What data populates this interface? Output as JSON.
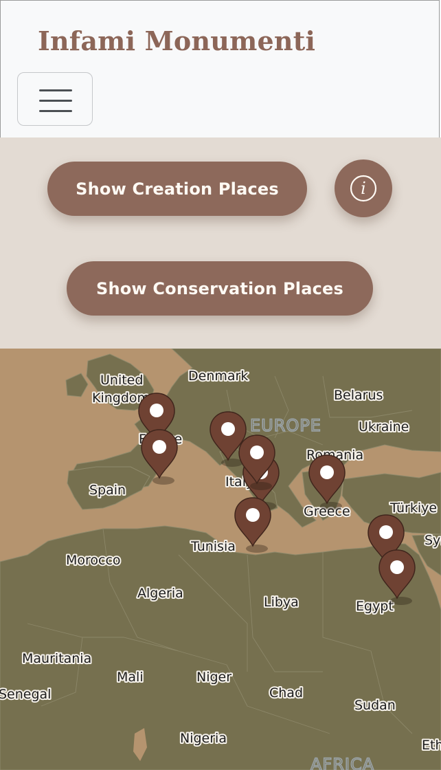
{
  "navbar": {
    "brand": "Infami Monumenti",
    "toggler_icon": "hamburger-menu-icon"
  },
  "controls": {
    "creation_button": "Show Creation Places",
    "conservation_button": "Show Conservation Places",
    "info_icon": "info-icon",
    "accent_color": "#8d695b"
  },
  "map": {
    "land_color": "#76704f",
    "sea_color": "#b5946f",
    "marker_color": "#6f4233",
    "region_labels": {
      "europe": "EUROPE",
      "africa": "AFRICA"
    },
    "labels": {
      "united": "United",
      "kingdom": "Kingdom",
      "denmark": "Denmark",
      "belarus": "Belarus",
      "ukraine": "Ukraine",
      "france": "France",
      "romania": "Romania",
      "spain": "Spain",
      "italy": "Italy",
      "greece": "Greece",
      "turkiye": "Türkiye",
      "syria": "Syria",
      "tunisia": "Tunisia",
      "morocco": "Morocco",
      "algeria": "Algeria",
      "libya": "Libya",
      "egypt": "Egypt",
      "mauritania": "Mauritania",
      "mali": "Mali",
      "niger": "Niger",
      "chad": "Chad",
      "sudan": "Sudan",
      "senegal": "Senegal",
      "nigeria": "Nigeria",
      "ethiopia": "Ethiopia"
    }
  }
}
